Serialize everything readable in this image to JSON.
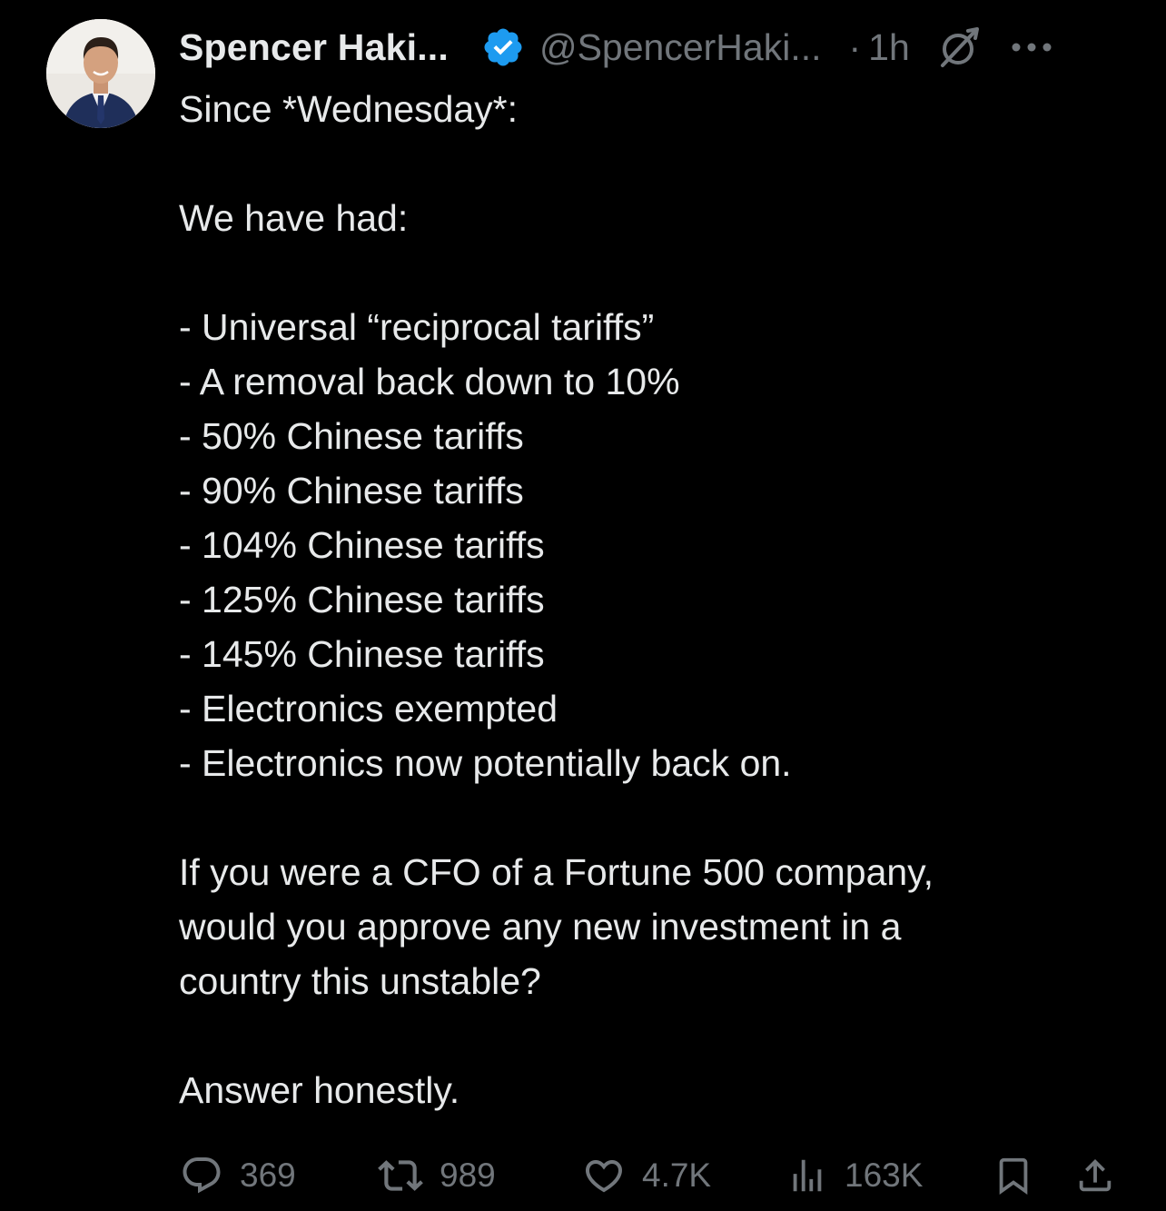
{
  "author": {
    "display_name": "Spencer Haki...",
    "handle": "@SpencerHaki...",
    "separator": "·",
    "time": "1h",
    "verified_color": "#1d9bf0"
  },
  "icons": {
    "avatar": "profile-photo",
    "verified": "verified-badge-icon",
    "grok": "grok-icon",
    "more": "more-options-icon",
    "reply": "reply-icon",
    "retweet": "retweet-icon",
    "like": "heart-icon",
    "views": "views-icon",
    "bookmark": "bookmark-icon",
    "share": "share-icon"
  },
  "tweet": {
    "lines": [
      "Since *Wednesday*:",
      "",
      "We have had:",
      "",
      "- Universal “reciprocal tariffs”",
      "- A removal back down to 10%",
      "- 50% Chinese tariffs",
      "- 90% Chinese tariffs",
      "- 104% Chinese tariffs",
      "- 125% Chinese tariffs",
      "- 145% Chinese tariffs",
      "- Electronics exempted",
      "- Electronics now potentially back on.",
      "",
      "If you were a CFO of a Fortune 500 company,",
      "would you approve any new investment in a",
      "country this unstable?",
      "",
      "Answer honestly."
    ]
  },
  "stats": {
    "replies": "369",
    "retweets": "989",
    "likes": "4.7K",
    "views": "163K"
  },
  "colors": {
    "background": "#000000",
    "text": "#e7e9ea",
    "muted": "#71767b",
    "accent": "#1d9bf0"
  }
}
